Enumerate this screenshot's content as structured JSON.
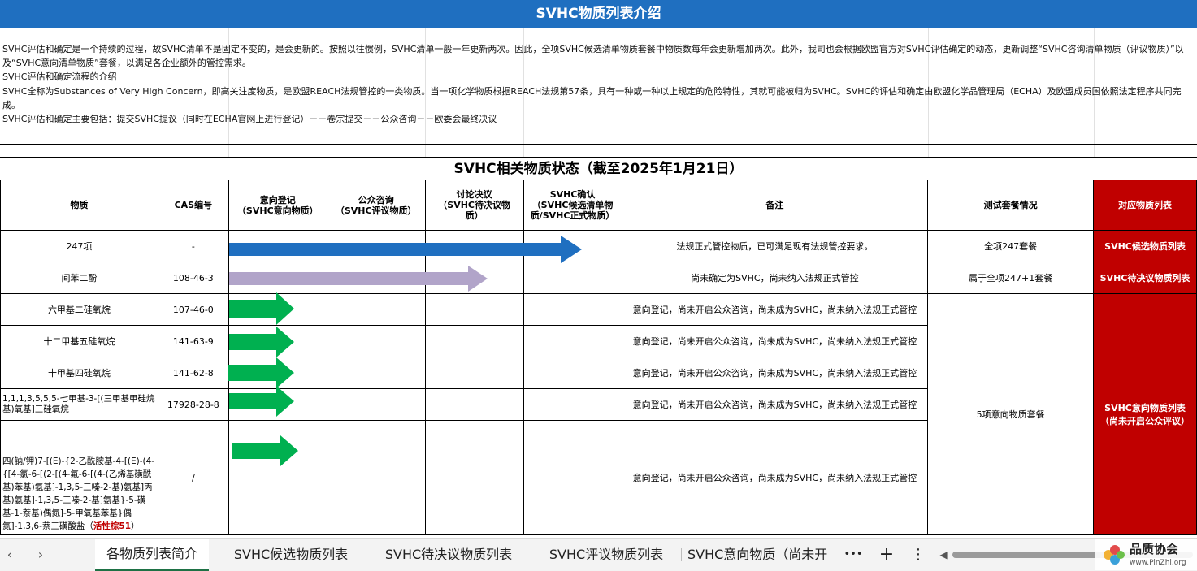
{
  "banner": {
    "title": "SVHC物质列表介绍"
  },
  "intro": [
    "SVHC评估和确定是一个持续的过程，故SVHC清单不是固定不变的，是会更新的。按照以往惯例，SVHC清单一般一年更新两次。因此，全项SVHC候选清单物质套餐中物质数每年会更新增加两次。此外，我司也会根据欧盟官方对SVHC评估确定的动态，更新调整“SVHC咨询清单物质（评议物质）”以及“SVHC意向清单物质”套餐，以满足各企业额外的管控需求。",
    "SVHC评估和确定流程的介绍",
    "SVHC全称为Substances of Very High Concern，即高关注度物质，是欧盟REACH法规管控的一类物质。当一项化学物质根据REACH法规第57条，具有一种或一种以上规定的危险特性，其就可能被归为SVHC。SVHC的评估和确定由欧盟化学品管理局（ECHA）及欧盟成员国依照法定程序共同完成。",
    "SVHC评估和确定主要包括：提交SVHC提议（同时在ECHA官网上进行登记）－－卷宗提交－－公众咨询－－欧委会最终决议"
  ],
  "status_title": "SVHC相关物质状态（截至2025年1月21日）",
  "headers": {
    "substance": "物质",
    "cas": "CAS编号",
    "intent": "意向登记\n（SVHC意向物质）",
    "consult": "公众咨询\n（SVHC评议物质）",
    "discuss": "讨论决议\n（SVHC待决议物\n质）",
    "confirm": "SVHC确认\n（SVHC候选清单物\n质/SVHC正式物质）",
    "remark": "备注",
    "package": "测试套餐情况",
    "list": "对应物质列表"
  },
  "rows": [
    {
      "substance": "247项",
      "cas": "-",
      "remark": "法规正式管控物质，已可满足现有法规管控要求。",
      "package": "全项247套餐",
      "list": "SVHC候选物质列表",
      "stage": "confirm",
      "arrow_color": "#1f6fc0"
    },
    {
      "substance": "间苯二酚",
      "cas": "108-46-3",
      "remark": "尚未确定为SVHC，尚未纳入法规正式管控",
      "package": "属于全项247+1套餐",
      "list": "SVHC待决议物质列表",
      "stage": "discuss",
      "arrow_color": "#b1a4c9"
    },
    {
      "substance": "六甲基二硅氧烷",
      "cas": "107-46-0",
      "remark": "意向登记，尚未开启公众咨询，尚未成为SVHC，尚未纳入法规正式管控",
      "stage": "intent",
      "arrow_color": "#00b050"
    },
    {
      "substance": "十二甲基五硅氧烷",
      "cas": "141-63-9",
      "remark": "意向登记，尚未开启公众咨询，尚未成为SVHC，尚未纳入法规正式管控",
      "stage": "intent",
      "arrow_color": "#00b050"
    },
    {
      "substance": "十甲基四硅氧烷",
      "cas": "141-62-8",
      "remark": "意向登记，尚未开启公众咨询，尚未成为SVHC，尚未纳入法规正式管控",
      "stage": "intent",
      "arrow_color": "#00b050"
    },
    {
      "substance": "1,1,1,3,5,5,5-七甲基-3-[(三甲基甲硅烷基)氧基]三硅氧烷",
      "cas": "17928-28-8",
      "remark": "意向登记，尚未开启公众咨询，尚未成为SVHC，尚未纳入法规正式管控",
      "stage": "intent",
      "arrow_color": "#00b050"
    },
    {
      "substance": "四(钠/钾)7-[(E)-{2-乙酰胺基-4-[(E)-(4-{[4-氯-6-[(2-[(4-氟-6-[(4-(乙烯基磺酰基)苯基)氨基]-1,3,5-三嗪-2-基)氨基]丙基)氨基]-1,3,5-三嗪-2-基]氨基}-5-磺基-1-萘基)偶氮]-5-甲氧基苯基}偶氮]-1,3,6-萘三磺酸盐（",
      "substance_hl": "活性棕51",
      "substance_end": "）",
      "cas": "/",
      "remark": "意向登记，尚未开启公众咨询，尚未成为SVHC，尚未纳入法规正式管控",
      "stage": "intent",
      "arrow_color": "#00b050"
    }
  ],
  "merged": {
    "package": "5项意向物质套餐",
    "list": "SVHC意向物质列表\n（尚未开启公众评议）"
  },
  "tabs": [
    {
      "label": "各物质列表简介",
      "active": true
    },
    {
      "label": "SVHC候选物质列表"
    },
    {
      "label": "SVHC待决议物质列表"
    },
    {
      "label": "SVHC评议物质列表"
    },
    {
      "label": "SVHC意向物质（尚未开"
    }
  ],
  "tabbar": {
    "prev": "‹",
    "next": "›",
    "more": "•••",
    "add": "+",
    "menu": "⋮",
    "scroll_left": "◀"
  },
  "logo": {
    "name": "品质协会",
    "url": "www.PinZhi.org"
  }
}
